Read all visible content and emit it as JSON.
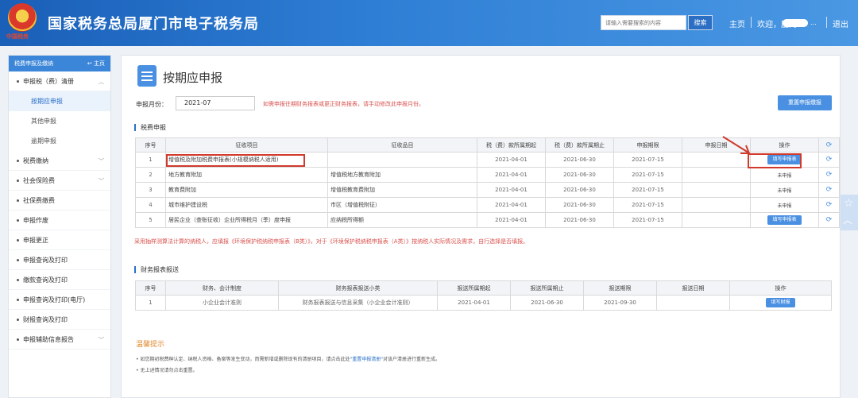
{
  "header": {
    "emblem_caption": "中国税务",
    "title": "国家税务总局厦门市电子税务局",
    "search_placeholder": "请输入需要搜索的内容",
    "search_button": "搜索",
    "home_link": "主页",
    "welcome": "欢迎，厦门",
    "welcome_suffix": "...",
    "logout": "退出"
  },
  "sidebar": {
    "header_label": "税费申报及缴纳",
    "home_label": "主页",
    "items": [
      {
        "label": "申报税（费）清册",
        "expanded": true
      },
      {
        "label": "按期应申报",
        "sub": true,
        "active": true
      },
      {
        "label": "其他申报",
        "sub": true
      },
      {
        "label": "逾期申报",
        "sub": true
      },
      {
        "label": "税费缴纳",
        "chevron": true
      },
      {
        "label": "社会保险费",
        "chevron": true
      },
      {
        "label": "社保费缴费"
      },
      {
        "label": "申报作废"
      },
      {
        "label": "申报更正"
      },
      {
        "label": "申报查询及打印"
      },
      {
        "label": "缴款查询及打印"
      },
      {
        "label": "申报查询及打印(电厅)"
      },
      {
        "label": "财报查询及打印"
      },
      {
        "label": "申报辅助信息报告",
        "chevron": true
      }
    ]
  },
  "main": {
    "page_title": "按期应申报",
    "period_label": "申报月份：",
    "period_value": "2021-07",
    "period_note": "如需申报往期财务报表或更正财务报表，请手动修改此申报月份。",
    "reset_button": "重置申报缴报",
    "tax_section_title": "税费申报",
    "tax_columns": [
      "序号",
      "征收项目",
      "征收品目",
      "税（费）款所属期起",
      "税（费）款所属期止",
      "申报期限",
      "申报日期",
      "操作",
      "⟳"
    ],
    "tax_rows": [
      {
        "no": "1",
        "item": "增值税及附加税费申报表(小规模纳税人适用)",
        "sub_item": "",
        "start": "2021-04-01",
        "end": "2021-06-30",
        "deadline": "2021-07-15",
        "date": "",
        "action": "填写申报表",
        "action_type": "button"
      },
      {
        "no": "2",
        "item": "地方教育附加",
        "sub_item": "增值税地方教育附加",
        "start": "2021-04-01",
        "end": "2021-06-30",
        "deadline": "2021-07-15",
        "date": "",
        "action": "未申报",
        "action_type": "text"
      },
      {
        "no": "3",
        "item": "教育费附加",
        "sub_item": "增值税教育费附加",
        "start": "2021-04-01",
        "end": "2021-06-30",
        "deadline": "2021-07-15",
        "date": "",
        "action": "未申报",
        "action_type": "text"
      },
      {
        "no": "4",
        "item": "城市维护建设税",
        "sub_item": "市区（增值税附征）",
        "start": "2021-04-01",
        "end": "2021-06-30",
        "deadline": "2021-07-15",
        "date": "",
        "action": "未申报",
        "action_type": "text"
      },
      {
        "no": "5",
        "item": "居民企业（查账征收）企业所得税月（季）度申报",
        "sub_item": "应纳税所得额",
        "start": "2021-04-01",
        "end": "2021-06-30",
        "deadline": "2021-07-15",
        "date": "",
        "action": "填写申报表",
        "action_type": "button"
      }
    ],
    "env_note": "采用抽样测算法计算的纳税人，应填报《环境保护税纳税申报表（B类）》，对于《环境保护税纳税申报表（A类）》按纳税人实际情况及需求，自行选择是否填报。",
    "fin_section_title": "财务报表报送",
    "fin_columns": [
      "序号",
      "财务、会计制度",
      "财务报表报送小类",
      "报送所属期起",
      "报送所属期止",
      "报送期限",
      "报送日期",
      "操作"
    ],
    "fin_rows": [
      {
        "no": "1",
        "system": "小企业会计准则",
        "category": "财务报表报送与信息采集（小企业会计准则）",
        "start": "2021-04-01",
        "end": "2021-06-30",
        "deadline": "2021-09-30",
        "date": "",
        "action": "填写财报"
      }
    ],
    "tips_title": "温馨提示",
    "tip1_a": "如您期初税费种认定、纳税人资格、备案等发生变动，而需新增或删除现有的清册项目，请点击此处",
    "tip1_link": "\"重置申报清册\"",
    "tip1_b": "对该户清册进行重新生成。",
    "tip2": "无上述情况请勿点击重置。"
  },
  "colors": {
    "header": "#2f7fd6",
    "accent": "#4a90e2",
    "highlight": "#d0392b"
  }
}
